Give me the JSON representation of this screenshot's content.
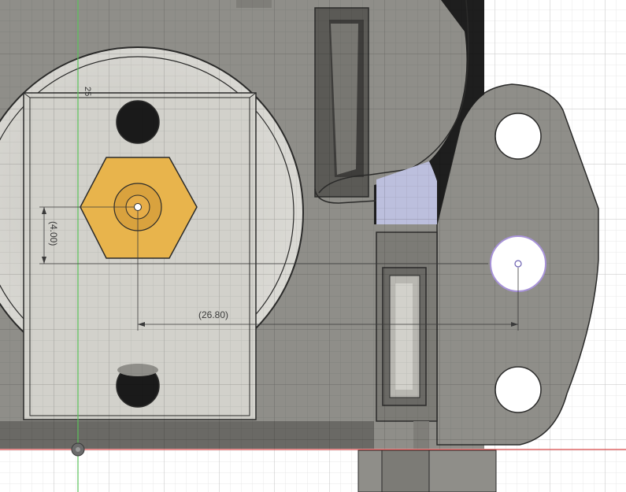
{
  "sketch": {
    "axis_label": "25",
    "dimensions": {
      "vertical_offset": "(4.00)",
      "horizontal_offset": "(26.80)"
    }
  },
  "colors": {
    "body_gray": "#8f8e89",
    "body_dark": "#585754",
    "plate": "#d2d1cb",
    "nozzle_gold": "#e8b44c",
    "selection_blue": "#bcbfdd",
    "y_axis_green": "#5ac25a",
    "x_axis_red": "#d84848"
  },
  "icons": {
    "origin_marker": "origin-point-icon"
  }
}
